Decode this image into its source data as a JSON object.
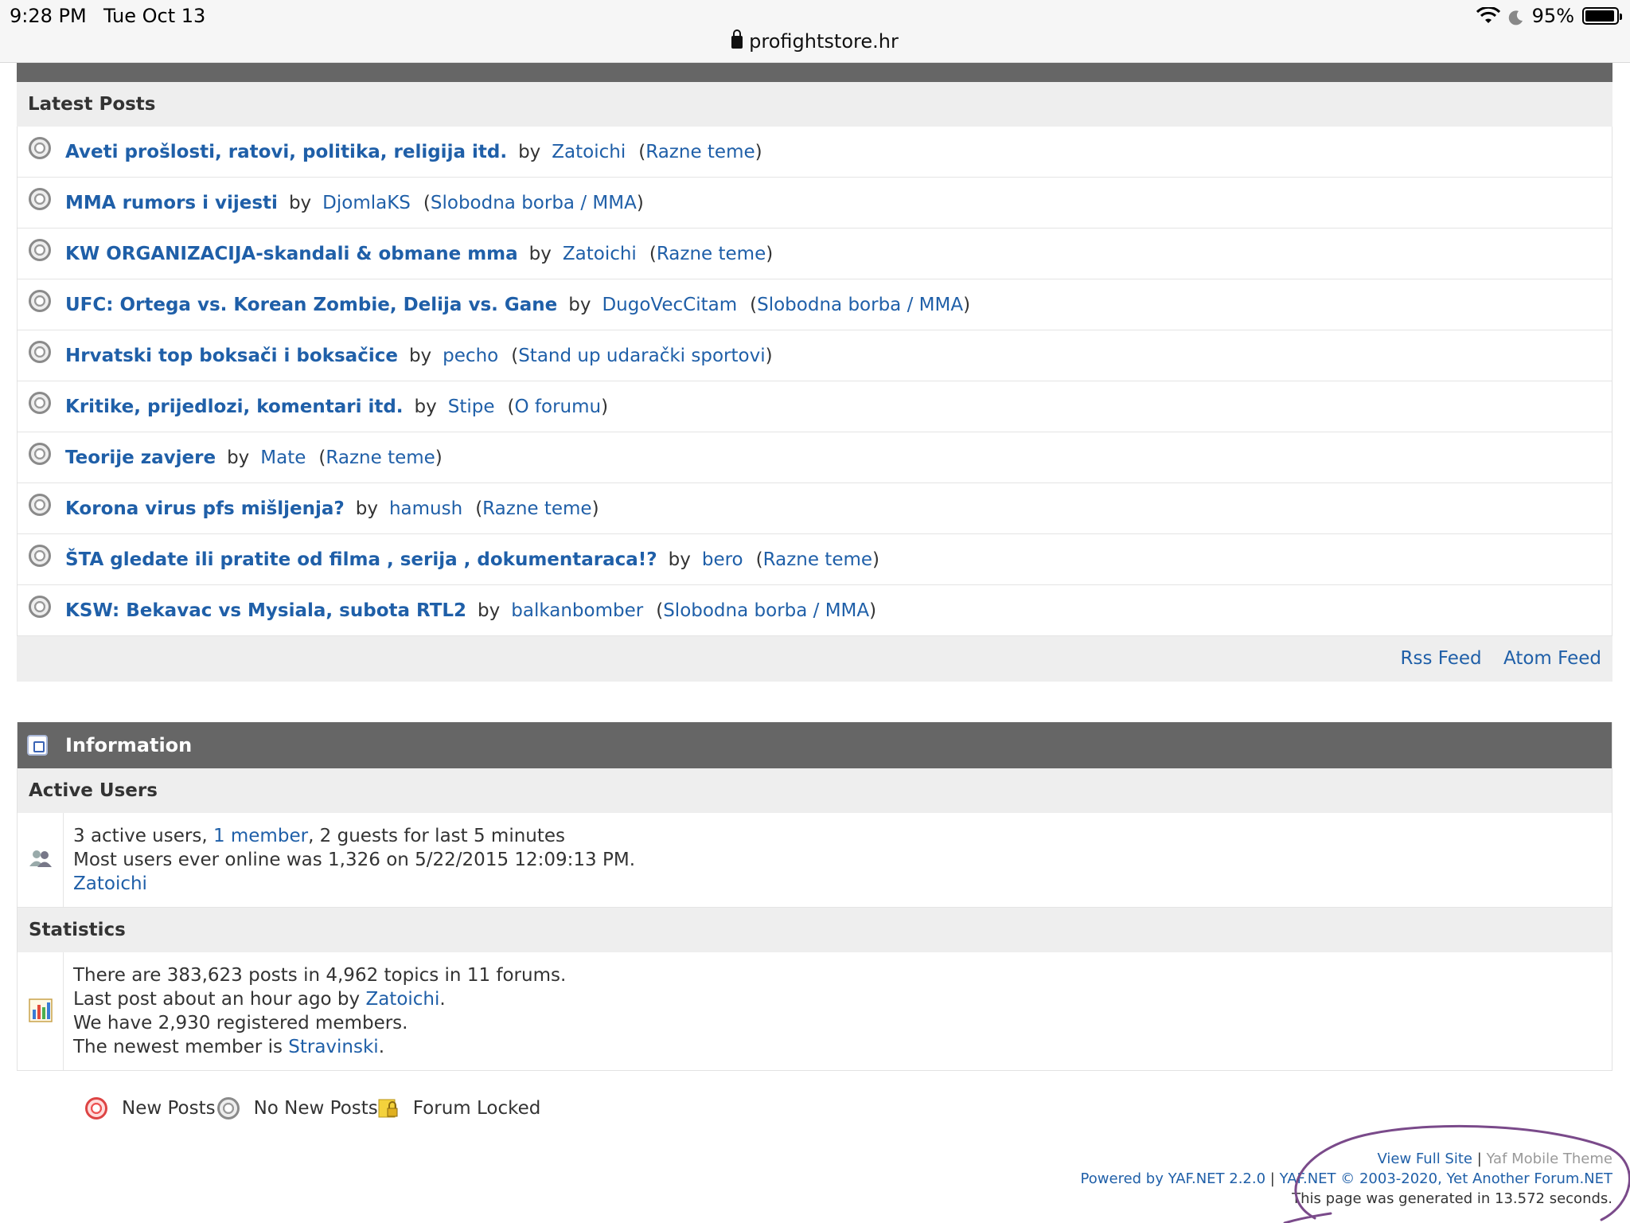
{
  "status_bar": {
    "time": "9:28 PM",
    "date": "Tue Oct 13",
    "battery": "95%",
    "battery_level": 0.95,
    "url": "profightstore.hr"
  },
  "latest_posts": {
    "heading": "Latest Posts",
    "by_label": "by",
    "posts": [
      {
        "topic": "Aveti prošlosti, ratovi, politika, religija itd.",
        "user": "Zatoichi",
        "forum": "Razne teme"
      },
      {
        "topic": "MMA rumors i vijesti",
        "user": "DjomlaKS",
        "forum": "Slobodna borba / MMA"
      },
      {
        "topic": "KW ORGANIZACIJA-skandali & obmane mma",
        "user": "Zatoichi",
        "forum": "Razne teme"
      },
      {
        "topic": "UFC: Ortega vs. Korean Zombie, Delija vs. Gane",
        "user": "DugoVecCitam",
        "forum": "Slobodna borba / MMA"
      },
      {
        "topic": "Hrvatski top boksači i boksačice",
        "user": "pecho",
        "forum": "Stand up udarački sportovi"
      },
      {
        "topic": "Kritike, prijedlozi, komentari itd.",
        "user": "Stipe",
        "forum": "O forumu"
      },
      {
        "topic": "Teorije zavjere",
        "user": "Mate",
        "forum": "Razne teme"
      },
      {
        "topic": "Korona virus pfs mišljenja?",
        "user": "hamush",
        "forum": "Razne teme"
      },
      {
        "topic": "ŠTA gledate ili pratite od filma , serija , dokumentaraca!?",
        "user": "bero",
        "forum": "Razne teme"
      },
      {
        "topic": "KSW: Bekavac vs Mysiala, subota RTL2",
        "user": "balkanbomber",
        "forum": "Slobodna borba / MMA"
      }
    ],
    "rss_label": "Rss Feed",
    "atom_label": "Atom Feed"
  },
  "information": {
    "title": "Information",
    "active_users": {
      "heading": "Active Users",
      "line1_prefix": "3 active users, ",
      "line1_link": "1 member",
      "line1_suffix": ", 2 guests for last 5 minutes",
      "line2": "Most users ever online was 1,326 on 5/22/2015 12:09:13 PM.",
      "user": "Zatoichi"
    },
    "statistics": {
      "heading": "Statistics",
      "line1": "There are 383,623 posts in 4,962 topics in 11 forums.",
      "line2_prefix": "Last post about an hour ago by ",
      "line2_user": "Zatoichi",
      "line2_suffix": ".",
      "line3": "We have 2,930 registered members.",
      "line4_prefix": "The newest member is ",
      "line4_user": "Stravinski",
      "line4_suffix": "."
    }
  },
  "legend": {
    "new_posts": "New Posts",
    "no_new_posts": "No New Posts",
    "forum_locked": "Forum Locked"
  },
  "footer": {
    "view_full_site": "View Full Site",
    "separator": "|",
    "mobile_theme": "Yaf Mobile Theme",
    "powered_by": "Powered by YAF.NET 2.2.0",
    "copyright": "YAF.NET © 2003-2020, Yet Another Forum.NET",
    "generated": "This page was generated in 13.572 seconds."
  },
  "colors": {
    "link": "#1f5fa8",
    "header_bg": "#666666",
    "subheader_bg": "#eeeeee",
    "annotation": "#7a4a8a"
  }
}
